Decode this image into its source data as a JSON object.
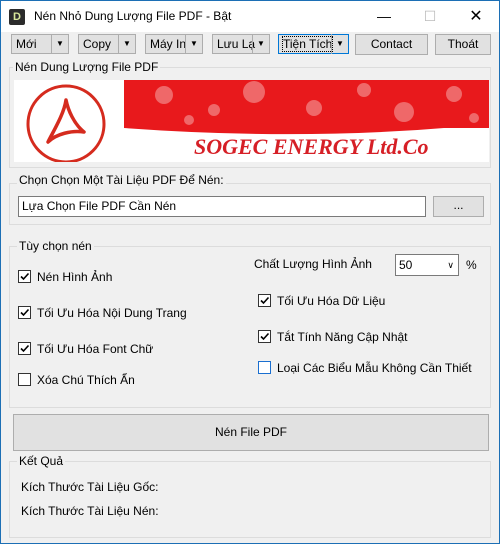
{
  "window": {
    "title": "Nén Nhỏ Dung Lượng File PDF - Bật",
    "icon": "D"
  },
  "toolbar": {
    "moi": "Mới",
    "copy": "Copy",
    "may_in": "Máy In",
    "luu_lai": "Lưu Lạ",
    "tien_tich": "Tiện Tích",
    "contact": "Contact",
    "thoat": "Thoát"
  },
  "banner_group": {
    "label": "Nén Dung Lượng File PDF"
  },
  "banner": {
    "company": "SOGEC ENERGY Ltd.Co",
    "brand_color": "#e8191c"
  },
  "file_group": {
    "label": "Chọn Chọn Một Tài Liệu PDF Để Nén:",
    "input_value": "Lựa Chọn File PDF Cần Nén",
    "browse_label": "..."
  },
  "options": {
    "label": "Tùy chọn nén",
    "nen_hinh_anh": "Nén Hình Ảnh",
    "toi_uu_noi_dung": "Tối Ưu Hóa Nội Dung Trang",
    "toi_uu_font": "Tối Ưu Hóa Font Chữ",
    "xoa_chu_thich": "Xóa Chú Thích Ẩn",
    "chat_luong_label": "Chất Lượng Hình Ảnh",
    "chat_luong_value": "50",
    "percent": "%",
    "toi_uu_du_lieu": "Tối Ưu Hóa Dữ Liệu",
    "tat_cap_nhat": "Tắt Tính Năng Cập Nhật",
    "loai_bieu_mau": "Loại Các Biểu Mẫu Không Cần Thiết"
  },
  "compress_button": "Nén File PDF",
  "result": {
    "label": "Kết Quả",
    "original_size": "Kích Thước Tài Liệu Gốc:",
    "compressed_size": "Kích Thước Tài Liệu Nén:"
  }
}
